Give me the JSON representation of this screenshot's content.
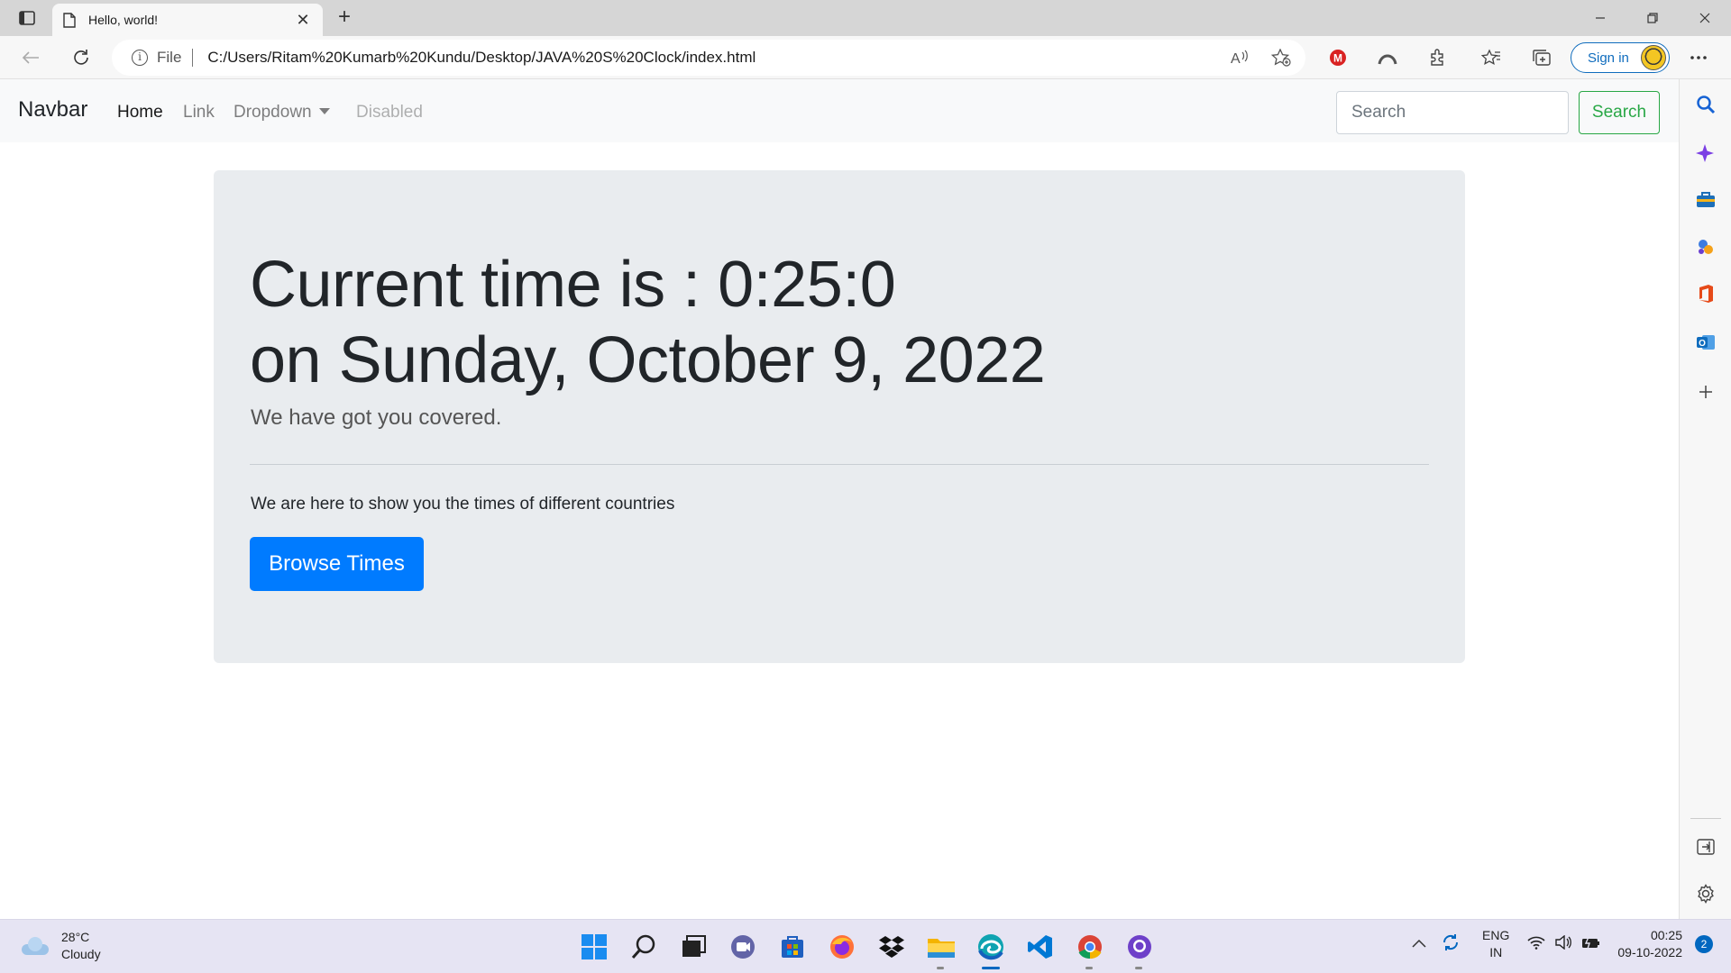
{
  "browser": {
    "tab_title": "Hello, world!",
    "scheme_label": "File",
    "url": "C:/Users/Ritam%20Kumarb%20Kundu/Desktop/JAVA%20S%20Clock/index.html",
    "signin_label": "Sign in"
  },
  "navbar": {
    "brand": "Navbar",
    "links": [
      "Home",
      "Link",
      "Dropdown",
      "Disabled"
    ],
    "search_placeholder": "Search",
    "search_button": "Search"
  },
  "jumbotron": {
    "time_line": "Current time is : 0:25:0",
    "date_line": "on Sunday, October 9, 2022",
    "lead": "We have got you covered.",
    "body": "We are here to show you the times of different countries",
    "button": "Browse Times"
  },
  "taskbar": {
    "weather_temp": "28°C",
    "weather_desc": "Cloudy",
    "lang_line1": "ENG",
    "lang_line2": "IN",
    "time": "00:25",
    "date": "09-10-2022",
    "notification_count": "2"
  },
  "colors": {
    "primary": "#007bff",
    "success": "#28a745",
    "jumbotron_bg": "#e9ecef",
    "edge_accent": "#0f6cbd"
  }
}
